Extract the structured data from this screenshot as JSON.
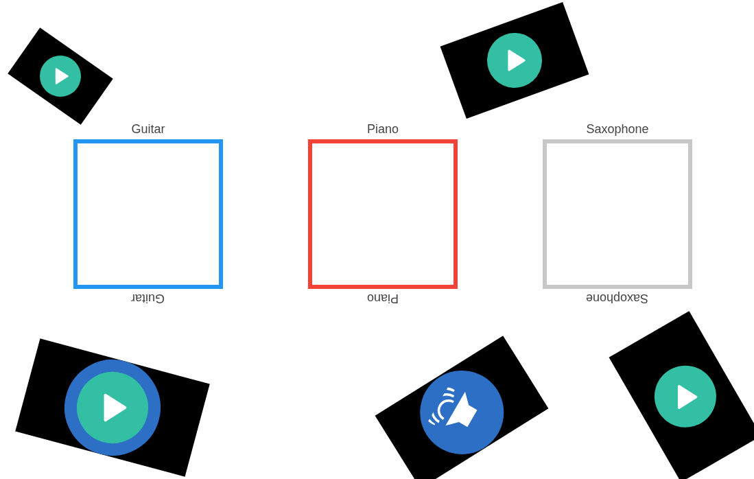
{
  "categories": [
    {
      "label": "Guitar",
      "mirror_label": "Guitar",
      "color": "#2196f3"
    },
    {
      "label": "Piano",
      "mirror_label": "Piano",
      "color": "#f44336"
    },
    {
      "label": "Saxophone",
      "mirror_label": "Saxophone",
      "color": "#c8c8c8"
    }
  ],
  "clips": [
    {
      "kind": "play",
      "highlighted": false
    },
    {
      "kind": "play",
      "highlighted": false
    },
    {
      "kind": "play",
      "highlighted": true
    },
    {
      "kind": "audio",
      "highlighted": true
    },
    {
      "kind": "play",
      "highlighted": false
    }
  ]
}
